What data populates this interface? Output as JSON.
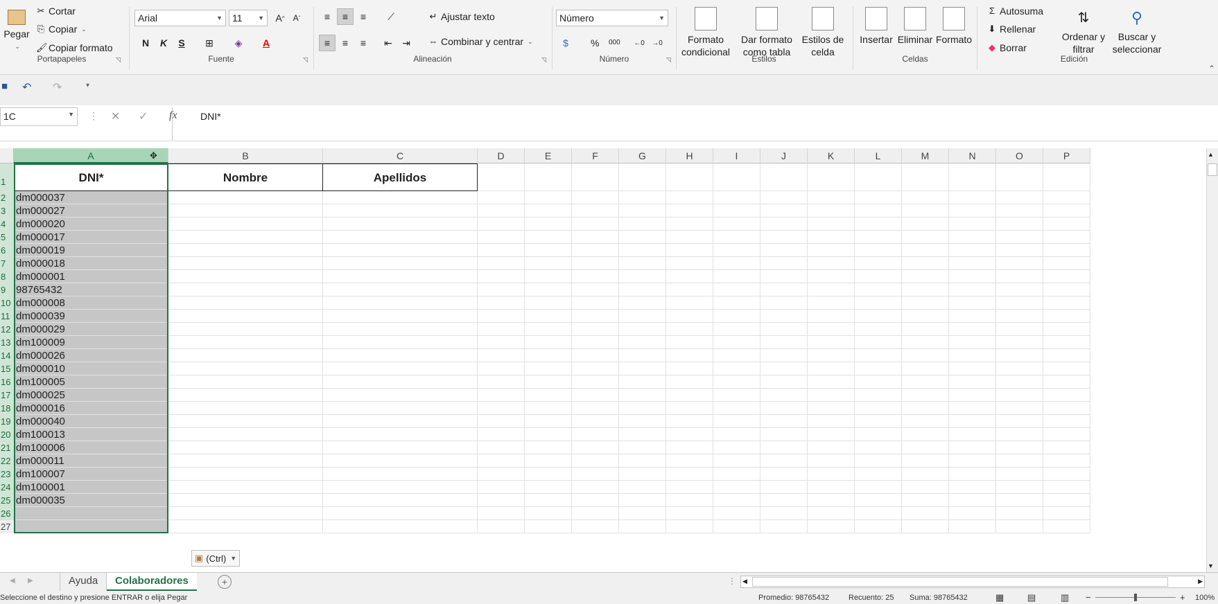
{
  "ribbon": {
    "portapapeles": {
      "paste": "Pegar",
      "cut": "Cortar",
      "copy": "Copiar",
      "format_painter": "Copiar formato",
      "label": "Portapapeles"
    },
    "fuente": {
      "font_name": "Arial",
      "font_size": "11",
      "bold": "N",
      "italic": "K",
      "underline": "S",
      "label": "Fuente"
    },
    "alineacion": {
      "wrap_text": "Ajustar texto",
      "merge_center": "Combinar y centrar",
      "label": "Alineación"
    },
    "numero": {
      "format": "Número",
      "percent": "%",
      "thousands": "000",
      "label": "Número"
    },
    "estilos": {
      "cond_format_1": "Formato",
      "cond_format_2": "condicional",
      "table_format_1": "Dar formato",
      "table_format_2": "como tabla",
      "cell_styles_1": "Estilos de",
      "cell_styles_2": "celda",
      "label": "Estilos"
    },
    "celdas": {
      "insert": "Insertar",
      "delete": "Eliminar",
      "format": "Formato",
      "label": "Celdas"
    },
    "edicion": {
      "autosum": "Autosuma",
      "fill": "Rellenar",
      "clear": "Borrar",
      "sort_1": "Ordenar y",
      "sort_2": "filtrar",
      "find_1": "Buscar y",
      "find_2": "seleccionar",
      "label": "Edición"
    }
  },
  "formula_bar": {
    "name_box": "1C",
    "content": "DNI*"
  },
  "columns": [
    "A",
    "B",
    "C",
    "D",
    "E",
    "F",
    "G",
    "H",
    "I",
    "J",
    "K",
    "L",
    "M",
    "N",
    "O",
    "P"
  ],
  "headers": {
    "a": "DNI*",
    "b": "Nombre",
    "c": "Apellidos"
  },
  "rows": [
    "dm000037",
    "dm000027",
    "dm000020",
    "dm000017",
    "dm000019",
    "dm000018",
    "dm000001",
    "98765432",
    "dm000008",
    "dm000039",
    "dm000029",
    "dm100009",
    "dm000026",
    "dm000010",
    "dm100005",
    "dm000025",
    "dm000016",
    "dm000040",
    "dm100013",
    "dm100006",
    "dm000011",
    "dm100007",
    "dm100001",
    "dm000035"
  ],
  "paste_options": "(Ctrl)",
  "sheets": {
    "tab1": "Ayuda",
    "tab2": "Colaboradores"
  },
  "status": {
    "message": "Seleccione el destino y presione ENTRAR o elija Pegar",
    "average": "Promedio: 98765432",
    "count": "Recuento: 25",
    "sum": "Suma: 98765432",
    "zoom": "100%"
  },
  "colors": {
    "accent": "#217346",
    "selection": "#c6c6c6"
  }
}
